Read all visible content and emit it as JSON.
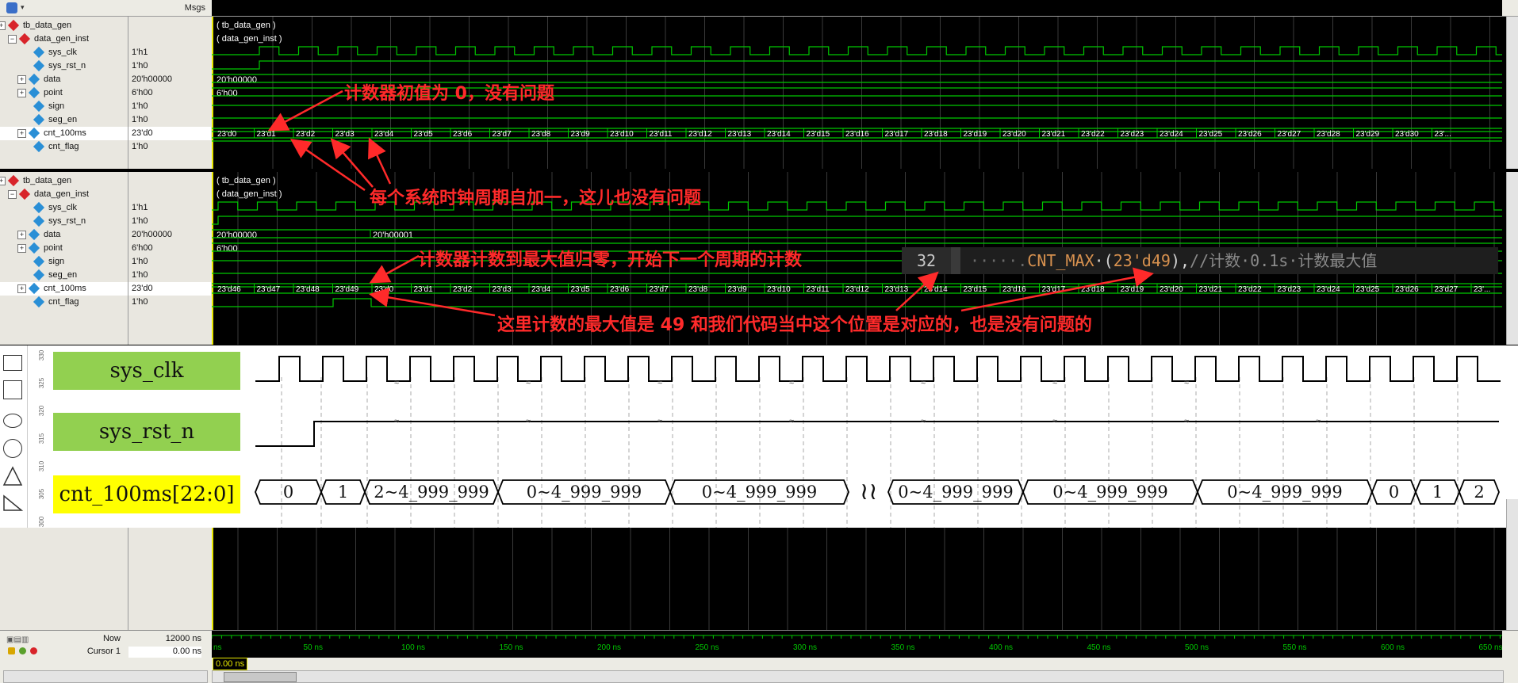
{
  "toolbar": {
    "msgs_label": "Msgs"
  },
  "panel1": {
    "rows": [
      {
        "name": "tb_data_gen",
        "value": ""
      },
      {
        "name": "data_gen_inst",
        "value": ""
      },
      {
        "name": "sys_clk",
        "value": "1'h1"
      },
      {
        "name": "sys_rst_n",
        "value": "1'h0"
      },
      {
        "name": "data",
        "value": "20'h00000"
      },
      {
        "name": "point",
        "value": "6'h00"
      },
      {
        "name": "sign",
        "value": "1'h0"
      },
      {
        "name": "seg_en",
        "value": "1'h0"
      },
      {
        "name": "cnt_100ms",
        "value": "23'd0"
      },
      {
        "name": "cnt_flag",
        "value": "1'h0"
      }
    ],
    "wave_labels": [
      "( tb_data_gen )",
      "( data_gen_inst )",
      "20'h00000",
      "6'h00"
    ],
    "cnt_values": [
      "23'd0",
      "23'd1",
      "23'd2",
      "23'd3",
      "23'd4",
      "23'd5",
      "23'd6",
      "23'd7",
      "23'd8",
      "23'd9",
      "23'd10",
      "23'd11",
      "23'd12",
      "23'd13",
      "23'd14",
      "23'd15",
      "23'd16",
      "23'd17",
      "23'd18",
      "23'd19",
      "23'd20",
      "23'd21",
      "23'd22",
      "23'd23",
      "23'd24",
      "23'd25",
      "23'd26",
      "23'd27",
      "23'd28",
      "23'd29",
      "23'd30",
      "23'..."
    ]
  },
  "panel2": {
    "rows": [
      {
        "name": "tb_data_gen",
        "value": ""
      },
      {
        "name": "data_gen_inst",
        "value": ""
      },
      {
        "name": "sys_clk",
        "value": "1'h1"
      },
      {
        "name": "sys_rst_n",
        "value": "1'h0"
      },
      {
        "name": "data",
        "value": "20'h00000"
      },
      {
        "name": "point",
        "value": "6'h00"
      },
      {
        "name": "sign",
        "value": "1'h0"
      },
      {
        "name": "seg_en",
        "value": "1'h0"
      },
      {
        "name": "cnt_100ms",
        "value": "23'd0"
      },
      {
        "name": "cnt_flag",
        "value": "1'h0"
      }
    ],
    "wave_labels": [
      "( tb_data_gen )",
      "( data_gen_inst )",
      "20'h00000",
      "20'h00001",
      "6'h00"
    ],
    "cnt_values": [
      "23'd46",
      "23'd47",
      "23'd48",
      "23'd49",
      "23'd0",
      "23'd1",
      "23'd2",
      "23'd3",
      "23'd4",
      "23'd5",
      "23'd6",
      "23'd7",
      "23'd8",
      "23'd9",
      "23'd10",
      "23'd11",
      "23'd12",
      "23'd13",
      "23'd14",
      "23'd15",
      "23'd16",
      "23'd17",
      "23'd18",
      "23'd19",
      "23'd20",
      "23'd21",
      "23'd22",
      "23'd23",
      "23'd24",
      "23'd25",
      "23'd26",
      "23'd27",
      "23'..."
    ]
  },
  "annotations": {
    "a1": "计数器初值为 0，没有问题",
    "a2": "每个系统时钟周期自加一，这儿也没有问题",
    "a3": "计数器计数到最大值归零，开始下一个周期的计数",
    "a4": "这里计数的最大值是 49 和我们代码当中这个位置是对应的，也是没有问题的"
  },
  "code": {
    "line_no": "32",
    "dots": "·····.",
    "param": "CNT_MAX",
    "paren_open": "·(",
    "literal": "23'd49",
    "paren_close": "),",
    "comment": "//计数·0.1s·计数最大值"
  },
  "timing": {
    "signals": [
      {
        "name": "sys_clk",
        "color": "#92d050"
      },
      {
        "name": "sys_rst_n",
        "color": "#92d050"
      },
      {
        "name": "cnt_100ms[22:0]",
        "color": "#ffff00"
      }
    ],
    "ruler_labels": [
      "330",
      "325",
      "320",
      "315",
      "310",
      "305",
      "300"
    ],
    "bus_values": [
      "0",
      "1",
      "2~4_999_999",
      "0~4_999_999",
      "0~4_999_999",
      "0~4_999_999",
      "0~4_999_999",
      "0~4_999_999",
      "0",
      "1",
      "2"
    ]
  },
  "bottom": {
    "now_label": "Now",
    "now_value": "12000 ns",
    "cursor_label": "Cursor 1",
    "cursor_value": "0.00 ns",
    "cursor_tag": "0.00 ns",
    "time_labels": [
      "ns",
      "50 ns",
      "100 ns",
      "150 ns",
      "200 ns",
      "250 ns",
      "300 ns",
      "350 ns",
      "400 ns",
      "450 ns",
      "500 ns",
      "550 ns",
      "600 ns",
      "650 ns"
    ]
  },
  "colors": {
    "wave_green": "#00c800",
    "annotation_red": "#ff2a2a",
    "cursor_yellow": "#e8e800"
  }
}
